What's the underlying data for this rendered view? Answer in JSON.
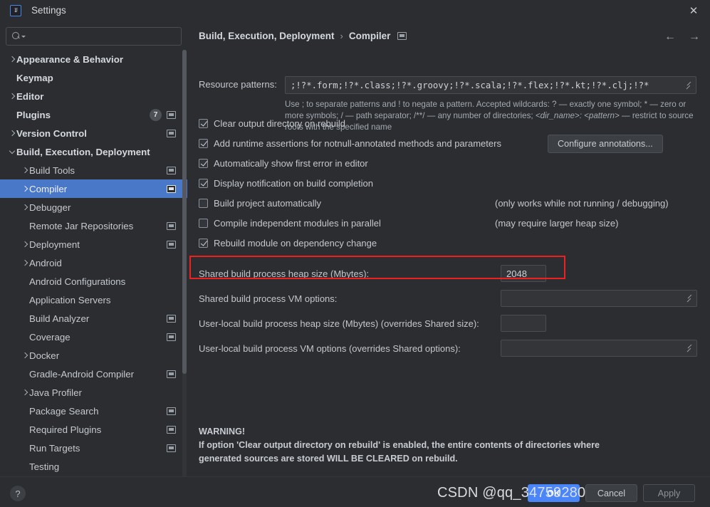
{
  "window": {
    "title": "Settings",
    "logo_text": "IJ",
    "close_label": "✕"
  },
  "search": {
    "value": "",
    "placeholder": ""
  },
  "sidebar": {
    "items": [
      {
        "label": "Appearance & Behavior",
        "indent": 0,
        "chevron": "right",
        "bold": true,
        "badge": "",
        "mod_icon": false,
        "selected": false
      },
      {
        "label": "Keymap",
        "indent": 0,
        "chevron": "none",
        "bold": true,
        "badge": "",
        "mod_icon": false,
        "selected": false
      },
      {
        "label": "Editor",
        "indent": 0,
        "chevron": "right",
        "bold": true,
        "badge": "",
        "mod_icon": false,
        "selected": false
      },
      {
        "label": "Plugins",
        "indent": 0,
        "chevron": "none",
        "bold": true,
        "badge": "7",
        "mod_icon": true,
        "selected": false
      },
      {
        "label": "Version Control",
        "indent": 0,
        "chevron": "right",
        "bold": true,
        "badge": "",
        "mod_icon": true,
        "selected": false
      },
      {
        "label": "Build, Execution, Deployment",
        "indent": 0,
        "chevron": "down",
        "bold": true,
        "badge": "",
        "mod_icon": false,
        "selected": false
      },
      {
        "label": "Build Tools",
        "indent": 1,
        "chevron": "right",
        "bold": false,
        "badge": "",
        "mod_icon": true,
        "selected": false
      },
      {
        "label": "Compiler",
        "indent": 1,
        "chevron": "right",
        "bold": false,
        "badge": "",
        "mod_icon": true,
        "selected": true
      },
      {
        "label": "Debugger",
        "indent": 1,
        "chevron": "right",
        "bold": false,
        "badge": "",
        "mod_icon": false,
        "selected": false
      },
      {
        "label": "Remote Jar Repositories",
        "indent": 1,
        "chevron": "none",
        "bold": false,
        "badge": "",
        "mod_icon": true,
        "selected": false
      },
      {
        "label": "Deployment",
        "indent": 1,
        "chevron": "right",
        "bold": false,
        "badge": "",
        "mod_icon": true,
        "selected": false
      },
      {
        "label": "Android",
        "indent": 1,
        "chevron": "right",
        "bold": false,
        "badge": "",
        "mod_icon": false,
        "selected": false
      },
      {
        "label": "Android Configurations",
        "indent": 1,
        "chevron": "none",
        "bold": false,
        "badge": "",
        "mod_icon": false,
        "selected": false
      },
      {
        "label": "Application Servers",
        "indent": 1,
        "chevron": "none",
        "bold": false,
        "badge": "",
        "mod_icon": false,
        "selected": false
      },
      {
        "label": "Build Analyzer",
        "indent": 1,
        "chevron": "none",
        "bold": false,
        "badge": "",
        "mod_icon": true,
        "selected": false
      },
      {
        "label": "Coverage",
        "indent": 1,
        "chevron": "none",
        "bold": false,
        "badge": "",
        "mod_icon": true,
        "selected": false
      },
      {
        "label": "Docker",
        "indent": 1,
        "chevron": "right",
        "bold": false,
        "badge": "",
        "mod_icon": false,
        "selected": false
      },
      {
        "label": "Gradle-Android Compiler",
        "indent": 1,
        "chevron": "none",
        "bold": false,
        "badge": "",
        "mod_icon": true,
        "selected": false
      },
      {
        "label": "Java Profiler",
        "indent": 1,
        "chevron": "right",
        "bold": false,
        "badge": "",
        "mod_icon": false,
        "selected": false
      },
      {
        "label": "Package Search",
        "indent": 1,
        "chevron": "none",
        "bold": false,
        "badge": "",
        "mod_icon": true,
        "selected": false
      },
      {
        "label": "Required Plugins",
        "indent": 1,
        "chevron": "none",
        "bold": false,
        "badge": "",
        "mod_icon": true,
        "selected": false
      },
      {
        "label": "Run Targets",
        "indent": 1,
        "chevron": "none",
        "bold": false,
        "badge": "",
        "mod_icon": true,
        "selected": false
      },
      {
        "label": "Testing",
        "indent": 1,
        "chevron": "none",
        "bold": false,
        "badge": "",
        "mod_icon": false,
        "selected": false
      }
    ]
  },
  "breadcrumb": {
    "parent": "Build, Execution, Deployment",
    "separator": "›",
    "current": "Compiler"
  },
  "main": {
    "resource_patterns_label": "Resource patterns:",
    "resource_patterns_value": ";!?*.form;!?*.class;!?*.groovy;!?*.scala;!?*.flex;!?*.kt;!?*.clj;!?*",
    "help_line1": "Use ; to separate patterns and ! to negate a pattern. Accepted wildcards: ? — exactly one symbol; * — zero",
    "help_line2a": "or more symbols; / — path separator; /**/ — any number of directories;  ",
    "help_line2b": "<dir_name>: <pattern>",
    "help_line2c": " — restrict",
    "help_line3": "to source roots with the specified name",
    "checkboxes": [
      {
        "label": "Clear output directory on rebuild",
        "checked": true,
        "note": ""
      },
      {
        "label": "Add runtime assertions for notnull-annotated methods and parameters",
        "checked": true,
        "note": ""
      },
      {
        "label": "Automatically show first error in editor",
        "checked": true,
        "note": ""
      },
      {
        "label": "Display notification on build completion",
        "checked": true,
        "note": ""
      },
      {
        "label": "Build project automatically",
        "checked": false,
        "note": "(only works while not running / debugging)"
      },
      {
        "label": "Compile independent modules in parallel",
        "checked": false,
        "note": "(may require larger heap size)"
      },
      {
        "label": "Rebuild module on dependency change",
        "checked": true,
        "note": ""
      }
    ],
    "configure_annotations_label": "Configure annotations...",
    "fields": [
      {
        "label": "Shared build process heap size (Mbytes):",
        "value": "2048",
        "size": "small",
        "expandable": false
      },
      {
        "label": "Shared build process VM options:",
        "value": "",
        "size": "wide",
        "expandable": true
      },
      {
        "label": "User-local build process heap size (Mbytes) (overrides Shared size):",
        "value": "",
        "size": "small",
        "expandable": false
      },
      {
        "label": "User-local build process VM options (overrides Shared options):",
        "value": "",
        "size": "wide",
        "expandable": true
      }
    ],
    "warning_title": "WARNING!",
    "warning_line1": "If option 'Clear output directory on rebuild' is enabled, the entire contents of directories where",
    "warning_line2": "generated sources are stored WILL BE CLEARED on rebuild."
  },
  "footer": {
    "help_label": "?",
    "ok_label": "OK",
    "cancel_label": "Cancel",
    "apply_label": "Apply"
  },
  "watermark": {
    "text": "CSDN @qq_34759280"
  },
  "colors": {
    "background": "#2b2d30",
    "selection": "#4a78c8",
    "accent_button": "#4a86f7",
    "highlight_box": "#ee2020",
    "text_primary": "#c7cbd1",
    "text_secondary": "#a4aab2"
  }
}
